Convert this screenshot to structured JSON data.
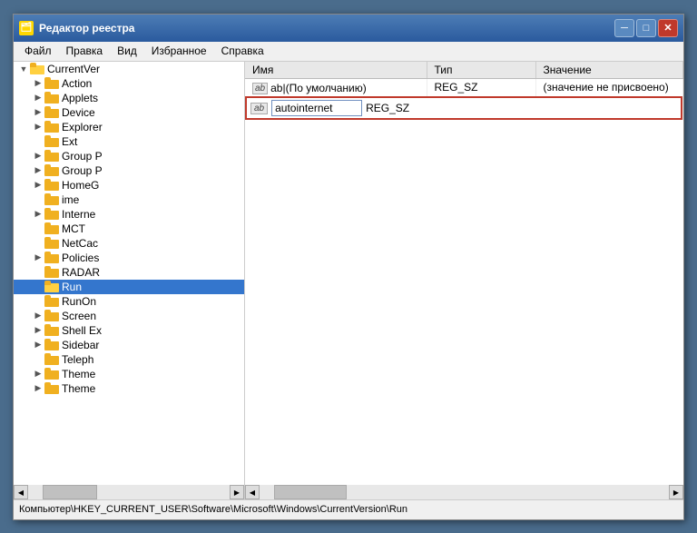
{
  "window": {
    "title": "Редактор реестра",
    "buttons": {
      "minimize": "─",
      "maximize": "□",
      "close": "✕"
    }
  },
  "menu": {
    "items": [
      "Файл",
      "Правка",
      "Вид",
      "Избранное",
      "Справка"
    ]
  },
  "tree": {
    "header": "Имя",
    "root": "CurrentVer",
    "items": [
      {
        "label": "Action",
        "indent": 2,
        "hasArrow": true
      },
      {
        "label": "Applets",
        "indent": 2,
        "hasArrow": true
      },
      {
        "label": "Device",
        "indent": 2,
        "hasArrow": true
      },
      {
        "label": "Explorer",
        "indent": 2,
        "hasArrow": true
      },
      {
        "label": "Ext",
        "indent": 2,
        "hasArrow": false
      },
      {
        "label": "Group P",
        "indent": 2,
        "hasArrow": true
      },
      {
        "label": "Group P",
        "indent": 2,
        "hasArrow": true
      },
      {
        "label": "HomeG",
        "indent": 2,
        "hasArrow": true
      },
      {
        "label": "ime",
        "indent": 2,
        "hasArrow": false
      },
      {
        "label": "Interne",
        "indent": 2,
        "hasArrow": true
      },
      {
        "label": "MCT",
        "indent": 2,
        "hasArrow": false
      },
      {
        "label": "NetCac",
        "indent": 2,
        "hasArrow": false
      },
      {
        "label": "Policies",
        "indent": 2,
        "hasArrow": true
      },
      {
        "label": "RADAR",
        "indent": 2,
        "hasArrow": false
      },
      {
        "label": "Run",
        "indent": 2,
        "hasArrow": false,
        "selected": true
      },
      {
        "label": "RunOn",
        "indent": 2,
        "hasArrow": false
      },
      {
        "label": "Screen",
        "indent": 2,
        "hasArrow": true
      },
      {
        "label": "Shell Ex",
        "indent": 2,
        "hasArrow": true
      },
      {
        "label": "Sidebar",
        "indent": 2,
        "hasArrow": true
      },
      {
        "label": "Teleph",
        "indent": 2,
        "hasArrow": false
      },
      {
        "label": "Theme",
        "indent": 2,
        "hasArrow": true
      },
      {
        "label": "Theme ",
        "indent": 2,
        "hasArrow": true
      }
    ]
  },
  "registry": {
    "columns": [
      "Имя",
      "Тип",
      "Значение"
    ],
    "rows": [
      {
        "name": "ab|(По умолчанию)",
        "type": "REG_SZ",
        "value": "(значение не присвоено)",
        "isDefault": true
      }
    ],
    "editRow": {
      "name": "autointernet",
      "type": "REG_SZ",
      "value": "",
      "abLabel": "ab"
    }
  },
  "statusBar": {
    "path": "Компьютер\\HKEY_CURRENT_USER\\Software\\Microsoft\\Windows\\CurrentVersion\\Run"
  }
}
